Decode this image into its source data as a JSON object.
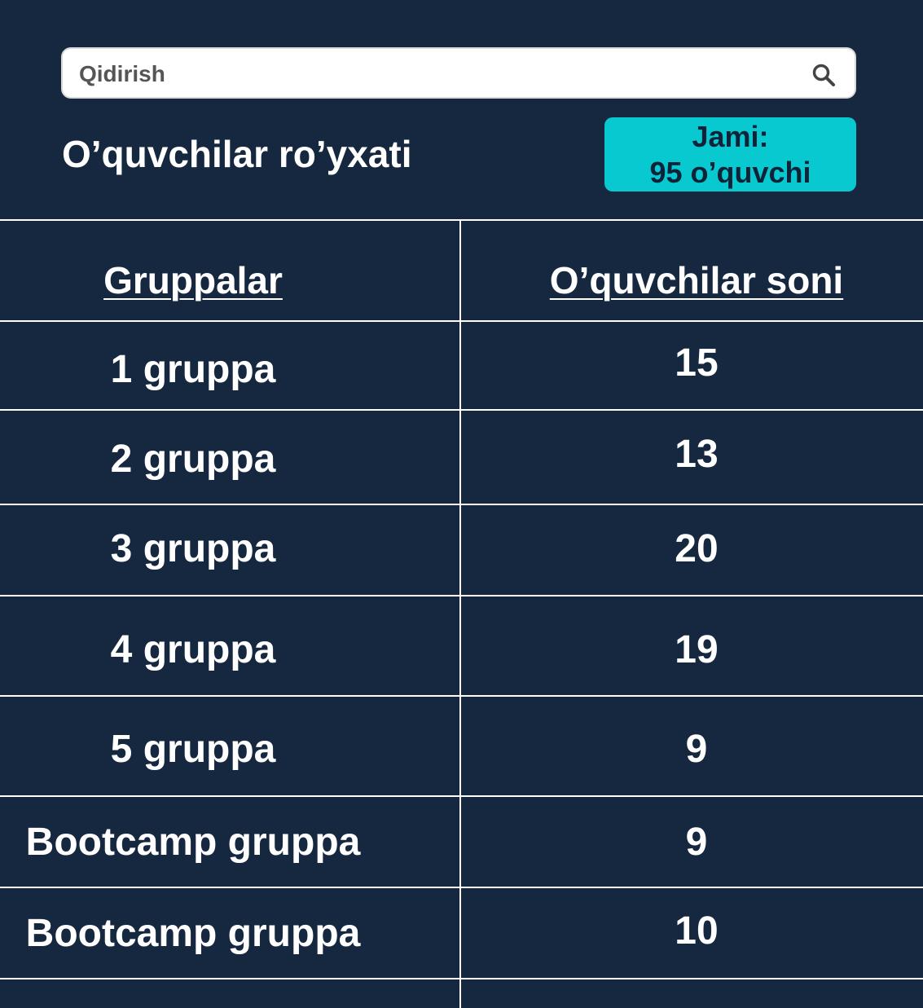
{
  "search": {
    "placeholder": "Qidirish"
  },
  "page": {
    "title": "O’quvchilar ro’yxati"
  },
  "summary": {
    "line1": "Jami:",
    "line2": "95 o’quvchi"
  },
  "table": {
    "headers": [
      "Gruppalar",
      "O’quvchilar soni"
    ],
    "rows": [
      {
        "group": "1 gruppa",
        "count": "15"
      },
      {
        "group": "2 gruppa",
        "count": "13"
      },
      {
        "group": "3 gruppa",
        "count": "20"
      },
      {
        "group": "4 gruppa",
        "count": "19"
      },
      {
        "group": "5 gruppa",
        "count": "9"
      },
      {
        "group": "Bootcamp gruppa",
        "count": "9"
      },
      {
        "group": "Bootcamp gruppa",
        "count": "10"
      }
    ]
  },
  "colors": {
    "background": "#16283f",
    "accent": "#08c9d0",
    "lines": "#ffffff"
  },
  "icons": {
    "search": "search-icon"
  }
}
